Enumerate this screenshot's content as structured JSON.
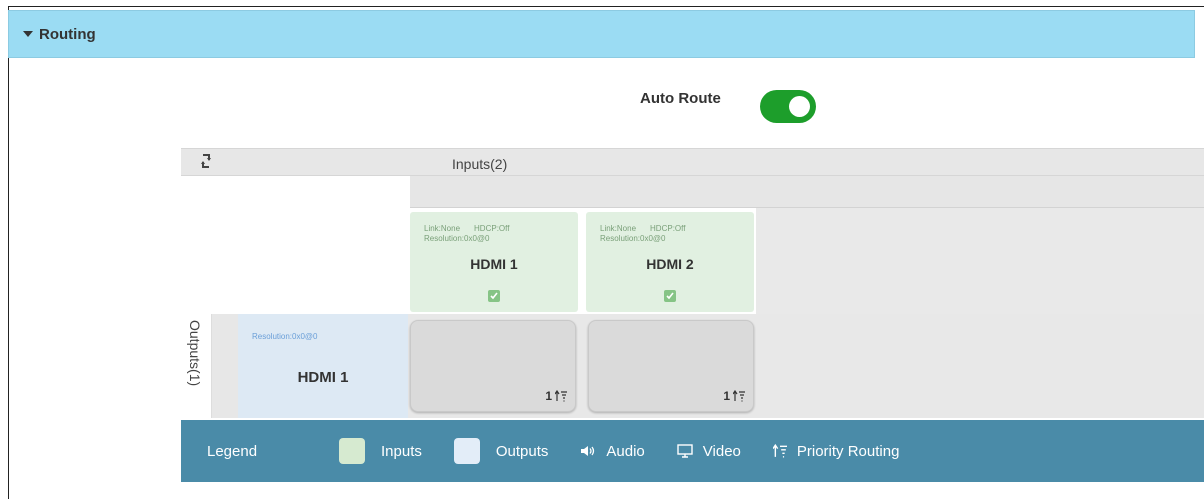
{
  "section": {
    "title": "Routing"
  },
  "auto_route": {
    "label": "Auto Route",
    "enabled": true
  },
  "grid": {
    "inputs_title": "Inputs(2)",
    "outputs_title": "Outputs(1)",
    "inputs": [
      {
        "link": "Link:None",
        "hdcp": "HDCP:Off",
        "resolution": "Resolution:0x0@0",
        "name": "HDMI 1",
        "checked": true
      },
      {
        "link": "Link:None",
        "hdcp": "HDCP:Off",
        "resolution": "Resolution:0x0@0",
        "name": "HDMI 2",
        "checked": true
      }
    ],
    "outputs": [
      {
        "resolution": "Resolution:0x0@0",
        "name": "HDMI 1"
      }
    ],
    "cells": [
      {
        "priority": "1"
      },
      {
        "priority": "1"
      }
    ]
  },
  "legend": {
    "title": "Legend",
    "inputs": "Inputs",
    "outputs": "Outputs",
    "audio": "Audio",
    "video": "Video",
    "priority": "Priority Routing"
  },
  "colors": {
    "header": "#9bdcf3",
    "toggle_on": "#1d9e2b",
    "input_card": "#e1f0e1",
    "output_card": "#dde9f4",
    "legend_bar": "#4a8ba8"
  }
}
